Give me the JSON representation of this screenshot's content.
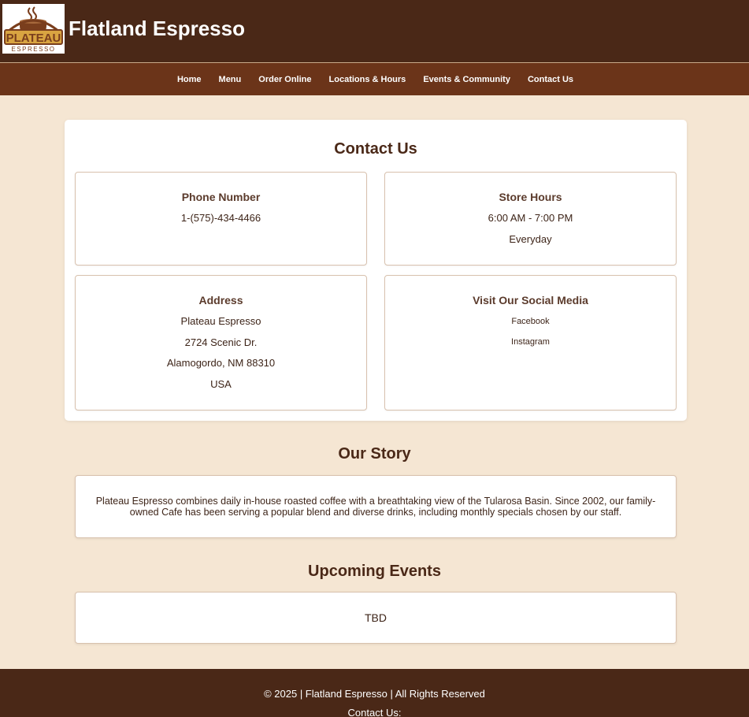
{
  "header": {
    "logo": {
      "text_top": "PLATEAU",
      "text_bottom": "ESPRESSO",
      "alt": "coffee-cup-logo"
    },
    "title": "Flatland Espresso"
  },
  "nav": {
    "items": [
      {
        "label": "Home"
      },
      {
        "label": "Menu"
      },
      {
        "label": "Order Online"
      },
      {
        "label": "Locations & Hours"
      },
      {
        "label": "Events & Community"
      },
      {
        "label": "Contact Us"
      }
    ]
  },
  "contact": {
    "title": "Contact Us",
    "phone": {
      "heading": "Phone Number",
      "value": "1-(575)-434-4466"
    },
    "hours": {
      "heading": "Store Hours",
      "time": "6:00 AM - 7:00 PM",
      "days": "Everyday"
    },
    "address": {
      "heading": "Address",
      "lines": [
        "Plateau Espresso",
        "2724 Scenic Dr.",
        "Alamogordo, NM 88310",
        "USA"
      ]
    },
    "social": {
      "heading": "Visit Our Social Media",
      "links": [
        "Facebook",
        "Instagram"
      ]
    }
  },
  "story": {
    "title": "Our Story",
    "text": "Plateau Espresso combines daily in-house roasted coffee with a breathtaking view of the Tularosa Basin. Since 2002, our family-owned Cafe has been serving a popular blend and diverse drinks, including monthly specials chosen by our staff."
  },
  "events": {
    "title": "Upcoming Events",
    "text": "TBD"
  },
  "footer": {
    "copyright": "© 2025 | Flatland Espresso | All Rights Reserved",
    "contact_label": "Contact Us:"
  },
  "colors": {
    "header_bg": "#4a2817",
    "nav_bg": "#6b3419",
    "page_bg": "#f5e6d3",
    "logo_brown": "#7a3e1d",
    "logo_gold": "#d9a441"
  }
}
